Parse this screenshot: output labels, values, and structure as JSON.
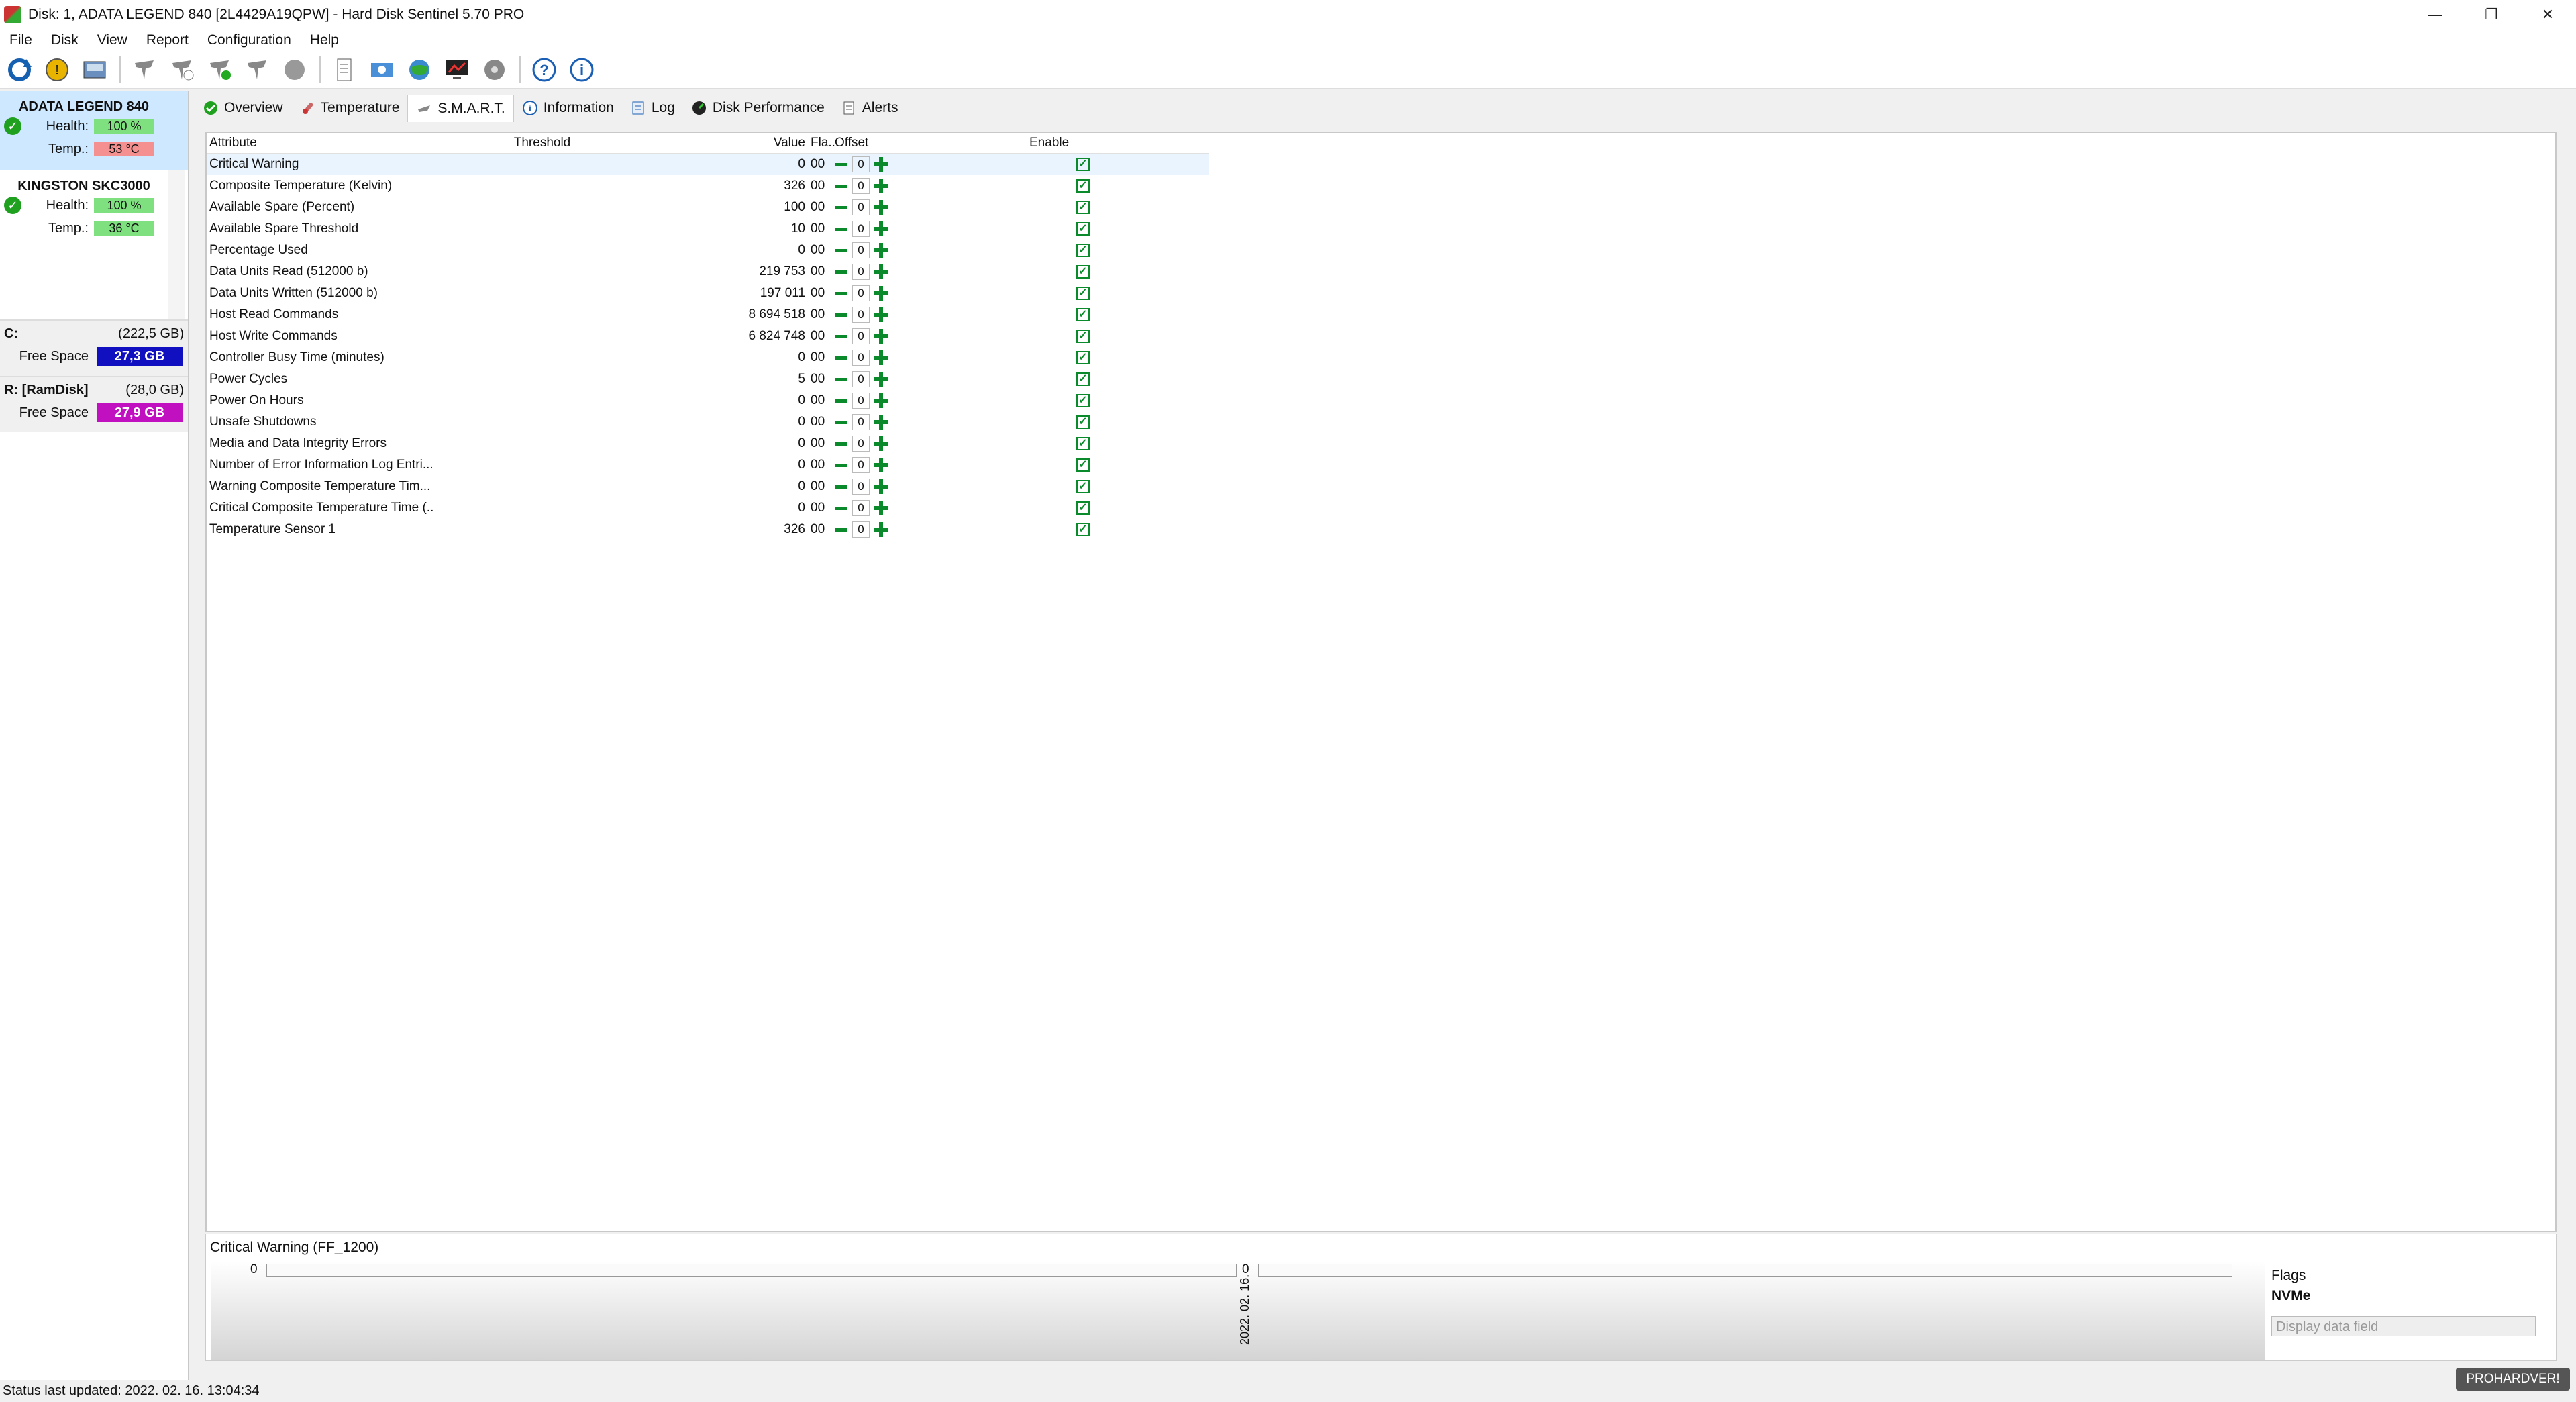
{
  "window": {
    "title": "Disk: 1, ADATA LEGEND 840 [2L4429A19QPW]  -  Hard Disk Sentinel 5.70 PRO"
  },
  "menu": [
    "File",
    "Disk",
    "View",
    "Report",
    "Configuration",
    "Help"
  ],
  "toolbar_icons": [
    "refresh-icon",
    "alert-icon",
    "disk-icon",
    "sentinel-icon",
    "sentinel-check-icon",
    "sentinel-ok-icon",
    "sentinel-off-icon",
    "blob-icon",
    "report-icon",
    "network-icon",
    "globe-icon",
    "monitor-icon",
    "disk-tools-icon",
    "help-icon",
    "info-icon"
  ],
  "disks": [
    {
      "name": "ADATA LEGEND 840",
      "health_label": "Health:",
      "health": "100 %",
      "temp_label": "Temp.:",
      "temp": "53 °C"
    },
    {
      "name": "KINGSTON SKC3000",
      "health_label": "Health:",
      "health": "100 %",
      "temp_label": "Temp.:",
      "temp": "36 °C"
    }
  ],
  "volumes": [
    {
      "name": "C:",
      "size": "(222,5 GB)",
      "free_label": "Free Space",
      "free": "27,3 GB",
      "color": "#1010c0"
    },
    {
      "name": "R: [RamDisk]",
      "size": "(28,0 GB)",
      "free_label": "Free Space",
      "free": "27,9 GB",
      "color": "#c010c0"
    }
  ],
  "tabs": [
    "Overview",
    "Temperature",
    "S.M.A.R.T.",
    "Information",
    "Log",
    "Disk Performance",
    "Alerts"
  ],
  "smart": {
    "headers": {
      "attribute": "Attribute",
      "threshold": "Threshold",
      "value": "Value",
      "flags": "Fla...",
      "offset": "Offset",
      "enable": "Enable"
    },
    "rows": [
      {
        "attr": "Critical Warning",
        "value": "0",
        "flags": "00",
        "offset": "0"
      },
      {
        "attr": "Composite Temperature (Kelvin)",
        "value": "326",
        "flags": "00",
        "offset": "0"
      },
      {
        "attr": "Available Spare (Percent)",
        "value": "100",
        "flags": "00",
        "offset": "0"
      },
      {
        "attr": "Available Spare Threshold",
        "value": "10",
        "flags": "00",
        "offset": "0"
      },
      {
        "attr": "Percentage Used",
        "value": "0",
        "flags": "00",
        "offset": "0"
      },
      {
        "attr": "Data Units Read (512000 b)",
        "value": "219 753",
        "flags": "00",
        "offset": "0"
      },
      {
        "attr": "Data Units Written (512000 b)",
        "value": "197 011",
        "flags": "00",
        "offset": "0"
      },
      {
        "attr": "Host Read Commands",
        "value": "8 694 518",
        "flags": "00",
        "offset": "0"
      },
      {
        "attr": "Host Write Commands",
        "value": "6 824 748",
        "flags": "00",
        "offset": "0"
      },
      {
        "attr": "Controller Busy Time (minutes)",
        "value": "0",
        "flags": "00",
        "offset": "0"
      },
      {
        "attr": "Power Cycles",
        "value": "5",
        "flags": "00",
        "offset": "0"
      },
      {
        "attr": "Power On Hours",
        "value": "0",
        "flags": "00",
        "offset": "0"
      },
      {
        "attr": "Unsafe Shutdowns",
        "value": "0",
        "flags": "00",
        "offset": "0"
      },
      {
        "attr": "Media and Data Integrity Errors",
        "value": "0",
        "flags": "00",
        "offset": "0"
      },
      {
        "attr": "Number of Error Information Log Entri...",
        "value": "0",
        "flags": "00",
        "offset": "0"
      },
      {
        "attr": "Warning Composite Temperature Tim...",
        "value": "0",
        "flags": "00",
        "offset": "0"
      },
      {
        "attr": "Critical Composite Temperature Time (...",
        "value": "0",
        "flags": "00",
        "offset": "0"
      },
      {
        "attr": "Temperature Sensor 1",
        "value": "326",
        "flags": "00",
        "offset": "0"
      }
    ]
  },
  "bottom": {
    "tab": "Critical Warning (FF_1200)",
    "graph_left_value": "0",
    "graph_right_value": "0",
    "graph_date": "2022. 02. 16.",
    "flags_label": "Flags",
    "flags_value": "NVMe",
    "display_field": "Display data field"
  },
  "status": "Status last updated: 2022. 02. 16. 13:04:34",
  "watermark": "PROHARDVER!"
}
